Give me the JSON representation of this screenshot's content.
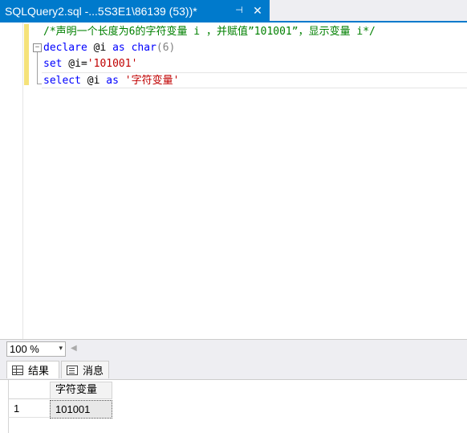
{
  "tab": {
    "title": "SQLQuery2.sql -...5S3E1\\86139 (53))*",
    "pin_icon": "pin-icon",
    "close_icon": "close-icon",
    "pin_glyph": "⊣",
    "close_glyph": "✕"
  },
  "editor": {
    "lines": [
      {
        "comment": "/*声明一个长度为6的字符变量 i ，并赋值”101001”，显示变量 i*/"
      },
      {
        "kw1": "declare",
        "sp1": " @i ",
        "kw2": "as",
        "sp2": " ",
        "kw3": "char",
        "paren": "(6)"
      },
      {
        "kw1": "set",
        "sp1": " @i=",
        "str": "'101001'"
      },
      {
        "kw1": "select",
        "sp1": " @i ",
        "kw2": "as",
        "sp2": " ",
        "str": "'字符变量'"
      }
    ],
    "fold_glyph": "−"
  },
  "zoom": {
    "value": "100 %",
    "arrow": "▾",
    "scroll_left": "◀"
  },
  "results_tabs": [
    {
      "label": "结果",
      "icon": "grid-icon"
    },
    {
      "label": "消息",
      "icon": "messages-icon"
    }
  ],
  "results": {
    "columns": [
      "字符变量"
    ],
    "rows": [
      {
        "num": "1",
        "values": [
          "101001"
        ]
      }
    ]
  },
  "colors": {
    "accent": "#007acc",
    "keyword": "#0000ff",
    "comment": "#008000",
    "string": "#c00000"
  }
}
